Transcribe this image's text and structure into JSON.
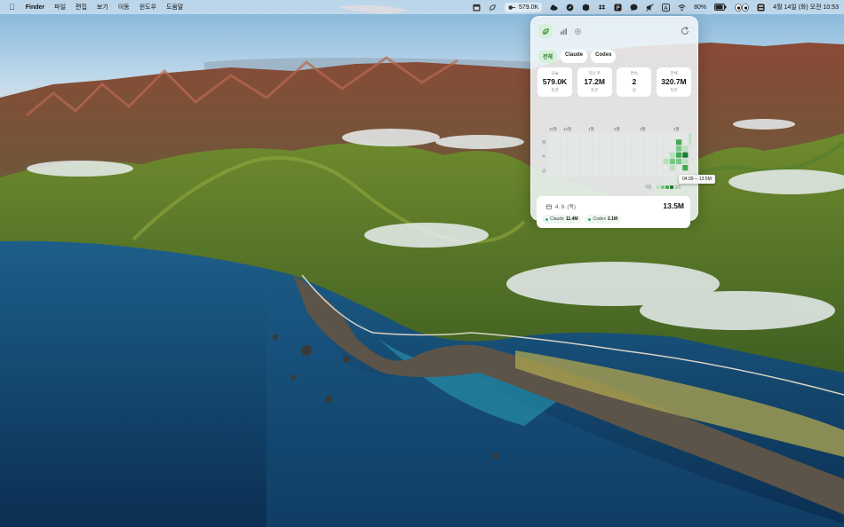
{
  "menubar": {
    "apple": "",
    "app": "Finder",
    "menus": [
      "파일",
      "편집",
      "보기",
      "이동",
      "윈도우",
      "도움말"
    ],
    "tokens_label": "579.0K",
    "battery": "80%",
    "clock": "4월 14일 (화) 오전 10:53",
    "status_icons": [
      "calendar-icon",
      "leaf-icon",
      "cloud-icon",
      "safari-icon",
      "cube-icon",
      "dropbox-icon",
      "p-icon",
      "chat-icon",
      "mute-icon",
      "text-input-icon",
      "wifi-icon",
      "battery-icon",
      "eyes-icon",
      "control-center-icon"
    ]
  },
  "popover": {
    "tabs": [
      {
        "label": "전체",
        "active": true
      },
      {
        "label": "Claude",
        "active": false
      },
      {
        "label": "Codex",
        "active": false
      }
    ],
    "stats": [
      {
        "label": "오늘",
        "value": "579.0K",
        "unit": "토큰"
      },
      {
        "label": "지난 주",
        "value": "17.2M",
        "unit": "토큰"
      },
      {
        "label": "연속",
        "value": "2",
        "unit": "일"
      },
      {
        "label": "전체",
        "value": "320.7M",
        "unit": "토큰"
      }
    ],
    "heatmap": {
      "months": [
        "11월",
        "12월",
        "1월",
        "2월",
        "3월",
        "4월"
      ],
      "day_labels": [
        "월",
        "수",
        "금"
      ],
      "active_cells": [
        {
          "week": 20,
          "day": 1,
          "level": 3
        },
        {
          "week": 20,
          "day": 2,
          "level": 2
        },
        {
          "week": 20,
          "day": 3,
          "level": 3
        },
        {
          "week": 20,
          "day": 4,
          "level": 2
        },
        {
          "week": 19,
          "day": 3,
          "level": 1
        },
        {
          "week": 19,
          "day": 4,
          "level": 2
        },
        {
          "week": 19,
          "day": 5,
          "level": 1
        },
        {
          "week": 21,
          "day": 2,
          "level": 1
        },
        {
          "week": 21,
          "day": 3,
          "level": 4
        },
        {
          "week": 21,
          "day": 4,
          "level": 1
        },
        {
          "week": 21,
          "day": 5,
          "level": 3
        },
        {
          "week": 22,
          "day": 1,
          "level": 1
        },
        {
          "week": 22,
          "day": 3,
          "level": 2
        },
        {
          "week": 22,
          "day": 4,
          "level": 1
        },
        {
          "week": 18,
          "day": 4,
          "level": 1
        },
        {
          "week": 22,
          "day": 0,
          "level": 1
        }
      ],
      "tooltip": "04.09 ─ 13.5M",
      "legend_less": "적음",
      "legend_more": "많음",
      "colors": [
        "#e4e8e6",
        "#b7e0bd",
        "#7cc887",
        "#43a853",
        "#1f7a31"
      ]
    },
    "detail": {
      "date": "4. 9. (목)",
      "total": "13.5M",
      "chips": [
        {
          "name": "Claude",
          "value": "11.4M",
          "color": "#2bb3a3"
        },
        {
          "name": "Codex",
          "value": "2.1M",
          "color": "#3aa864"
        }
      ]
    }
  }
}
